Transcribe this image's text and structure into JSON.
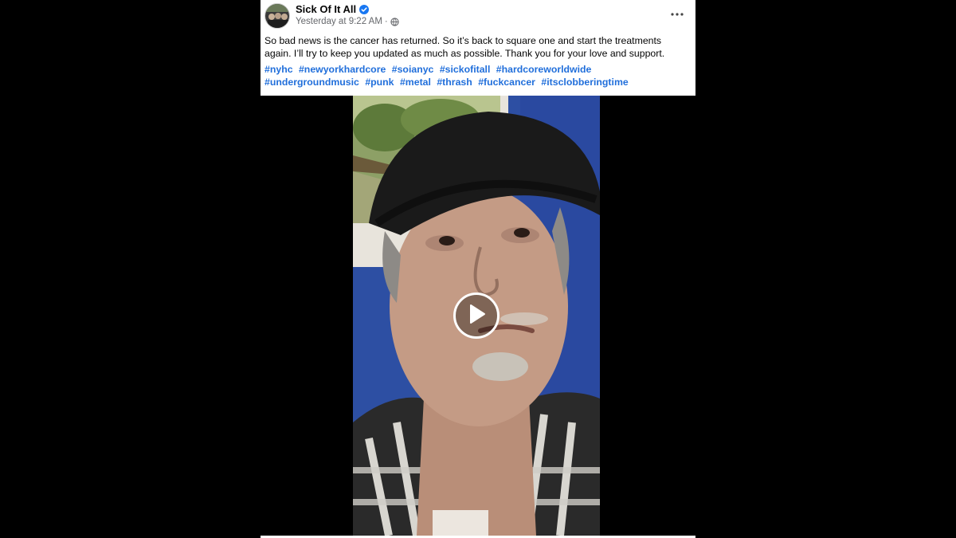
{
  "post": {
    "page_name": "Sick Of It All",
    "timestamp": "Yesterday at 9:22 AM",
    "separator": "·",
    "audience_icon": "globe-icon",
    "verified_icon": "verified-badge-icon",
    "more_icon": "more-options-icon",
    "caption": "So bad news is the cancer has returned. So it’s back to square one and start the treatments again. I’ll try to keep you updated as much as possible. Thank you for your love and support.",
    "hashtags": [
      "#nyhc",
      "#newyorkhardcore",
      "#soianyc",
      "#sickofitall",
      "#hardcoreworldwide",
      "#undergroundmusic",
      "#punk",
      "#metal",
      "#thrash",
      "#fuckcancer",
      "#itsclobberingtime"
    ]
  },
  "video": {
    "play_icon": "play-icon"
  },
  "colors": {
    "link": "#216fdb",
    "verified": "#1877f2",
    "background": "#000000"
  }
}
